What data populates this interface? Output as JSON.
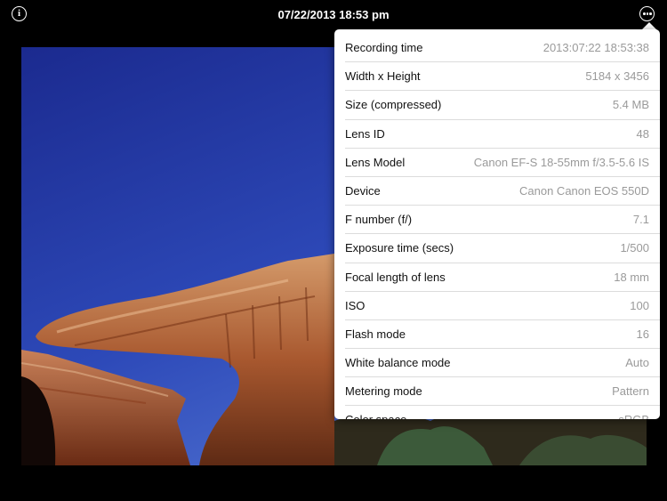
{
  "header": {
    "title": "07/22/2013 18:53 pm",
    "info_glyph": "i"
  },
  "colors": {
    "background": "#000000",
    "sky": "#2a3fa8",
    "rock": "#b86a3e",
    "value_text": "#9a9a9a"
  },
  "exif": {
    "rows": [
      {
        "key": "Recording time",
        "value": "2013:07:22 18:53:38"
      },
      {
        "key": "Width x Height",
        "value": "5184 x 3456"
      },
      {
        "key": "Size (compressed)",
        "value": "5.4 MB"
      },
      {
        "key": "Lens ID",
        "value": "48"
      },
      {
        "key": "Lens Model",
        "value": "Canon EF-S 18-55mm f/3.5-5.6 IS"
      },
      {
        "key": "Device",
        "value": "Canon Canon EOS 550D"
      },
      {
        "key": "F number (f/)",
        "value": "7.1"
      },
      {
        "key": "Exposure time (secs)",
        "value": "1/500"
      },
      {
        "key": "Focal length of lens",
        "value": "18 mm"
      },
      {
        "key": "ISO",
        "value": "100"
      },
      {
        "key": "Flash mode",
        "value": "16"
      },
      {
        "key": "White balance mode",
        "value": "Auto"
      },
      {
        "key": "Metering mode",
        "value": "Pattern"
      },
      {
        "key": "Color space",
        "value": "sRGB"
      }
    ]
  }
}
